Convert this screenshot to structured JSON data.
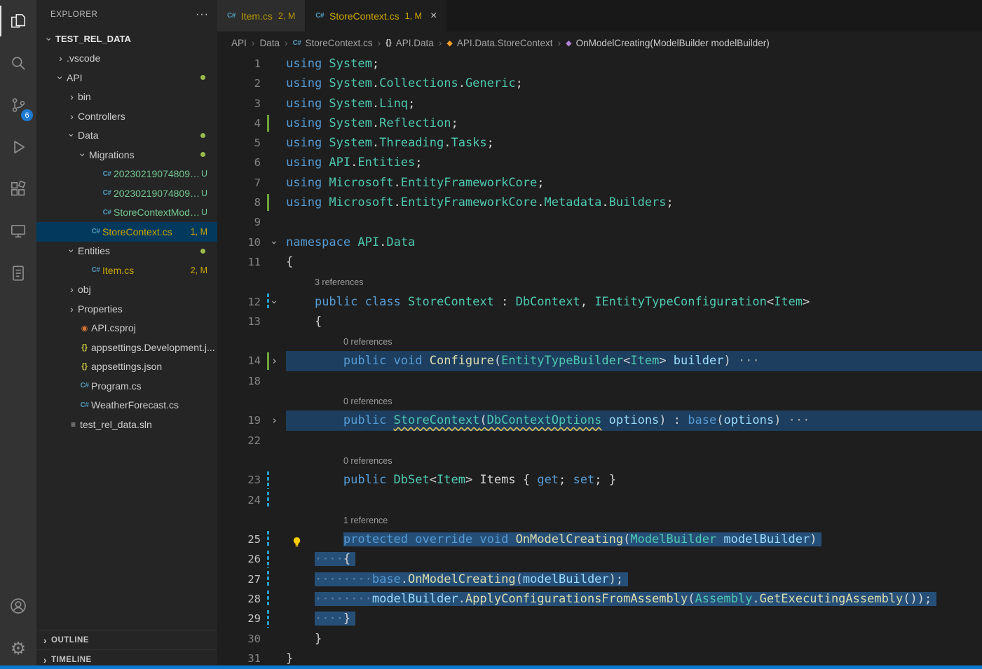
{
  "colors": {
    "selection": "#264f78",
    "fold_line_highlight": "#1d3e5e",
    "warning": "#cca700",
    "untracked": "#73c991",
    "status_bar": "#0a7ad4",
    "keyword": "#569cd6",
    "type": "#4ec9b0",
    "method": "#dcdcaa",
    "variable": "#9cdcfe"
  },
  "activity_bar": {
    "items": [
      {
        "name": "explorer",
        "active": true
      },
      {
        "name": "search"
      },
      {
        "name": "source-control",
        "badge": "6"
      },
      {
        "name": "run-and-debug"
      },
      {
        "name": "extensions"
      },
      {
        "name": "remote-explorer"
      },
      {
        "name": "outline-document"
      },
      {
        "name": "accounts",
        "bottom": true
      },
      {
        "name": "settings-gear",
        "bottom": true
      }
    ]
  },
  "sidebar": {
    "header": {
      "title": "EXPLORER",
      "menu": "···"
    },
    "tree": [
      {
        "label": "TEST_REL_DATA",
        "indent": 0,
        "chevron": "down",
        "bold": true
      },
      {
        "label": ".vscode",
        "indent": 1,
        "chevron": "right"
      },
      {
        "label": "API",
        "indent": 1,
        "chevron": "down",
        "dot": true
      },
      {
        "label": "bin",
        "indent": 2,
        "chevron": "right"
      },
      {
        "label": "Controllers",
        "indent": 2,
        "chevron": "right"
      },
      {
        "label": "Data",
        "indent": 2,
        "chevron": "down",
        "dot": true
      },
      {
        "label": "Migrations",
        "indent": 3,
        "chevron": "down",
        "dot": true
      },
      {
        "label": "20230219074809_I...",
        "indent": 4,
        "icon": "csharp",
        "badge": "U",
        "untracked": true
      },
      {
        "label": "20230219074809_I...",
        "indent": 4,
        "icon": "csharp",
        "badge": "U",
        "untracked": true
      },
      {
        "label": "StoreContextMode...",
        "indent": 4,
        "icon": "csharp",
        "badge": "U",
        "untracked": true
      },
      {
        "label": "StoreContext.cs",
        "indent": 3,
        "icon": "csharp",
        "badge": "1, M",
        "warning": true,
        "selected": true
      },
      {
        "label": "Entities",
        "indent": 2,
        "chevron": "down",
        "dot": true
      },
      {
        "label": "Item.cs",
        "indent": 3,
        "icon": "csharp",
        "badge": "2, M",
        "warning": true
      },
      {
        "label": "obj",
        "indent": 2,
        "chevron": "right"
      },
      {
        "label": "Properties",
        "indent": 2,
        "chevron": "right"
      },
      {
        "label": "API.csproj",
        "indent": 2,
        "icon": "csproj"
      },
      {
        "label": "appsettings.Development.j...",
        "indent": 2,
        "icon": "json"
      },
      {
        "label": "appsettings.json",
        "indent": 2,
        "icon": "json"
      },
      {
        "label": "Program.cs",
        "indent": 2,
        "icon": "csharp"
      },
      {
        "label": "WeatherForecast.cs",
        "indent": 2,
        "icon": "csharp"
      },
      {
        "label": "test_rel_data.sln",
        "indent": 1,
        "icon": "sln"
      }
    ],
    "panels": [
      {
        "label": "OUTLINE"
      },
      {
        "label": "TIMELINE"
      }
    ]
  },
  "tabs": [
    {
      "label": "Item.cs",
      "badge": "2, M",
      "icon": "csharp",
      "active": false,
      "close": false
    },
    {
      "label": "StoreContext.cs",
      "badge": "1, M",
      "icon": "csharp",
      "active": true,
      "close": true,
      "close_glyph": "×"
    }
  ],
  "breadcrumb": [
    {
      "label": "API"
    },
    {
      "label": "Data"
    },
    {
      "label": "StoreContext.cs",
      "icon": "csharp"
    },
    {
      "label": "API.Data",
      "icon": "namespace"
    },
    {
      "label": "API.Data.StoreContext",
      "icon": "class"
    },
    {
      "label": "OnModelCreating(ModelBuilder modelBuilder)",
      "icon": "method"
    }
  ],
  "editor": {
    "rows": [
      {
        "n": "1",
        "t": [
          [
            "using ",
            "kw"
          ],
          [
            "System",
            "ty"
          ],
          [
            ";",
            "tx"
          ]
        ]
      },
      {
        "n": "2",
        "t": [
          [
            "using ",
            "kw"
          ],
          [
            "System",
            "ty"
          ],
          [
            ".",
            "tx"
          ],
          [
            "Collections",
            "ty"
          ],
          [
            ".",
            "tx"
          ],
          [
            "Generic",
            "ty"
          ],
          [
            ";",
            "tx"
          ]
        ]
      },
      {
        "n": "3",
        "t": [
          [
            "using ",
            "kw"
          ],
          [
            "System",
            "ty"
          ],
          [
            ".",
            "tx"
          ],
          [
            "Linq",
            "ty"
          ],
          [
            ";",
            "tx"
          ]
        ]
      },
      {
        "n": "4",
        "chg": "add",
        "t": [
          [
            "using ",
            "kw"
          ],
          [
            "System",
            "ty"
          ],
          [
            ".",
            "tx"
          ],
          [
            "Reflection",
            "ty"
          ],
          [
            ";",
            "tx"
          ]
        ]
      },
      {
        "n": "5",
        "t": [
          [
            "using ",
            "kw"
          ],
          [
            "System",
            "ty"
          ],
          [
            ".",
            "tx"
          ],
          [
            "Threading",
            "ty"
          ],
          [
            ".",
            "tx"
          ],
          [
            "Tasks",
            "ty"
          ],
          [
            ";",
            "tx"
          ]
        ]
      },
      {
        "n": "6",
        "t": [
          [
            "using ",
            "kw"
          ],
          [
            "API",
            "ty"
          ],
          [
            ".",
            "tx"
          ],
          [
            "Entities",
            "ty"
          ],
          [
            ";",
            "tx"
          ]
        ]
      },
      {
        "n": "7",
        "t": [
          [
            "using ",
            "kw"
          ],
          [
            "Microsoft",
            "ty"
          ],
          [
            ".",
            "tx"
          ],
          [
            "EntityFrameworkCore",
            "ty"
          ],
          [
            ";",
            "tx"
          ]
        ]
      },
      {
        "n": "8",
        "chg": "add",
        "t": [
          [
            "using ",
            "kw"
          ],
          [
            "Microsoft",
            "ty"
          ],
          [
            ".",
            "tx"
          ],
          [
            "EntityFrameworkCore",
            "ty"
          ],
          [
            ".",
            "tx"
          ],
          [
            "Metadata",
            "ty"
          ],
          [
            ".",
            "tx"
          ],
          [
            "Builders",
            "ty"
          ],
          [
            ";",
            "tx"
          ]
        ]
      },
      {
        "n": "9",
        "t": []
      },
      {
        "n": "10",
        "fold": "down",
        "t": [
          [
            "namespace ",
            "kw"
          ],
          [
            "API",
            "ty"
          ],
          [
            ".",
            "tx"
          ],
          [
            "Data",
            "ty"
          ]
        ]
      },
      {
        "n": "11",
        "t": [
          [
            "{",
            "tx"
          ]
        ]
      },
      {
        "k": "lens",
        "text": "3 references",
        "indent": 4
      },
      {
        "n": "12",
        "fold": "down",
        "chg": "mod",
        "t": [
          [
            "    ",
            "tx"
          ],
          [
            "public ",
            "kw"
          ],
          [
            "class ",
            "kw"
          ],
          [
            "StoreContext",
            "ty"
          ],
          [
            " : ",
            "tx"
          ],
          [
            "DbContext",
            "ty"
          ],
          [
            ", ",
            "tx"
          ],
          [
            "IEntityTypeConfiguration",
            "ty"
          ],
          [
            "<",
            "tx"
          ],
          [
            "Item",
            "ty"
          ],
          [
            ">",
            "tx"
          ]
        ]
      },
      {
        "n": "13",
        "t": [
          [
            "    {",
            "tx"
          ]
        ]
      },
      {
        "k": "lens",
        "text": "0 references",
        "indent": 8
      },
      {
        "n": "14",
        "fold": "right",
        "chg": "add",
        "hl": true,
        "t": [
          [
            "        ",
            "tx"
          ],
          [
            "public ",
            "kw"
          ],
          [
            "void ",
            "kw"
          ],
          [
            "Configure",
            "fn"
          ],
          [
            "(",
            "tx"
          ],
          [
            "EntityTypeBuilder",
            "ty"
          ],
          [
            "<",
            "tx"
          ],
          [
            "Item",
            "ty"
          ],
          [
            "> ",
            "tx"
          ],
          [
            "builder",
            "va"
          ],
          [
            ")",
            "tx"
          ],
          [
            " ···",
            "fold-dots"
          ]
        ]
      },
      {
        "n": "18",
        "t": []
      },
      {
        "k": "lens",
        "text": "0 references",
        "indent": 8
      },
      {
        "n": "19",
        "fold": "right",
        "hl": true,
        "t": [
          [
            "        ",
            "tx"
          ],
          [
            "public ",
            "kw"
          ],
          [
            "StoreContext",
            "ty",
            "sq"
          ],
          [
            "(",
            "tx",
            "sq"
          ],
          [
            "DbContextOptions",
            "ty",
            "sq"
          ],
          [
            " ",
            "tx"
          ],
          [
            "options",
            "va"
          ],
          [
            ") : ",
            "tx"
          ],
          [
            "base",
            "kw"
          ],
          [
            "(",
            "tx"
          ],
          [
            "options",
            "va"
          ],
          [
            ")",
            "tx"
          ],
          [
            " ···",
            "fold-dots"
          ]
        ]
      },
      {
        "n": "22",
        "t": []
      },
      {
        "k": "lens",
        "text": "0 references",
        "indent": 8
      },
      {
        "n": "23",
        "chg": "mod",
        "t": [
          [
            "        ",
            "tx"
          ],
          [
            "public ",
            "kw"
          ],
          [
            "DbSet",
            "ty"
          ],
          [
            "<",
            "tx"
          ],
          [
            "Item",
            "ty"
          ],
          [
            "> ",
            "tx"
          ],
          [
            "Items ",
            "tx"
          ],
          [
            "{ ",
            "tx"
          ],
          [
            "get",
            "kw"
          ],
          [
            "; ",
            "tx"
          ],
          [
            "set",
            "kw"
          ],
          [
            "; ",
            "tx"
          ],
          [
            "}",
            "tx"
          ]
        ]
      },
      {
        "n": "24",
        "chg": "mod",
        "t": []
      },
      {
        "k": "lens",
        "text": "1 reference",
        "indent": 8
      },
      {
        "n": "25",
        "chg": "mod",
        "selnum": true,
        "bulb": true,
        "pre": "        ",
        "dots": 0,
        "t": [
          [
            "protected ",
            "kw"
          ],
          [
            "override ",
            "kw"
          ],
          [
            "void ",
            "kw"
          ],
          [
            "OnModelCreating",
            "fn"
          ],
          [
            "(",
            "tx"
          ],
          [
            "ModelBuilder ",
            "ty"
          ],
          [
            "modelBuilder",
            "va"
          ],
          [
            ")",
            "tx"
          ]
        ]
      },
      {
        "n": "26",
        "chg": "mod",
        "selnum": true,
        "pre": "    ",
        "dots": 4,
        "t": [
          [
            "{",
            "tx"
          ]
        ]
      },
      {
        "n": "27",
        "chg": "mod",
        "selnum": true,
        "pre": "    ",
        "dots": 8,
        "t": [
          [
            "base",
            "kw"
          ],
          [
            ".",
            "tx"
          ],
          [
            "OnModelCreating",
            "fn"
          ],
          [
            "(",
            "tx"
          ],
          [
            "modelBuilder",
            "va"
          ],
          [
            ");",
            "tx"
          ]
        ]
      },
      {
        "n": "28",
        "chg": "mod",
        "selnum": true,
        "pre": "    ",
        "dots": 8,
        "t": [
          [
            "modelBuilder",
            "va"
          ],
          [
            ".",
            "tx"
          ],
          [
            "ApplyConfigurationsFromAssembly",
            "fn"
          ],
          [
            "(",
            "tx"
          ],
          [
            "Assembly",
            "ty"
          ],
          [
            ".",
            "tx"
          ],
          [
            "GetExecutingAssembly",
            "fn"
          ],
          [
            "());",
            "tx"
          ]
        ]
      },
      {
        "n": "29",
        "chg": "mod",
        "selnum": true,
        "pre": "    ",
        "dots": 4,
        "t": [
          [
            "}",
            "tx"
          ]
        ]
      },
      {
        "n": "30",
        "t": [
          [
            "    }",
            "tx"
          ]
        ]
      },
      {
        "n": "31",
        "t": [
          [
            "}",
            "tx"
          ]
        ]
      }
    ]
  }
}
